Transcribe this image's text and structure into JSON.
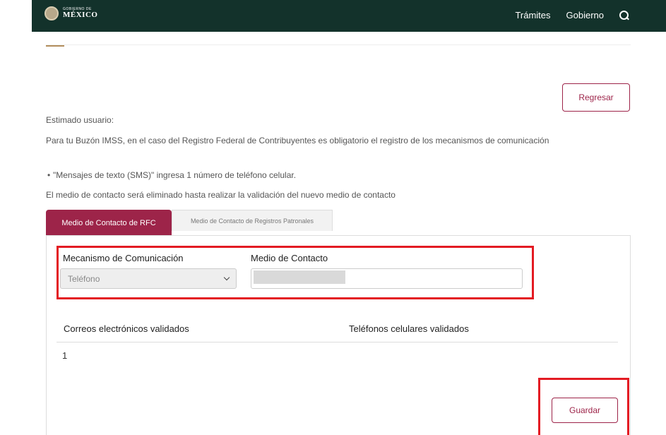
{
  "header": {
    "logo_small": "GOBIERNO DE",
    "logo_big": "MÉXICO",
    "nav": [
      "Trámites",
      "Gobierno"
    ],
    "search_icon": "search-icon"
  },
  "page": {
    "regresar_label": "Regresar",
    "greeting": "Estimado usuario:",
    "paragraph": "Para tu Buzón IMSS, en el caso del Registro Federal de Contribuyentes es obligatorio el registro de los mecanismos de comunicación",
    "bullet": "\"Mensajes de texto (SMS)\" ingresa 1 número de teléfono celular.",
    "notice": "El medio de contacto será eliminado hasta realizar la validación del nuevo medio de contacto"
  },
  "tabs": [
    {
      "label": "Medio de Contacto de RFC",
      "active": true
    },
    {
      "label": "Medio de Contacto de Registros Patronales",
      "active": false
    }
  ],
  "form": {
    "mechanism_label": "Mecanismo de Comunicación",
    "mechanism_value": "Teléfono",
    "contact_label": "Medio de Contacto"
  },
  "validated": {
    "emails_header": "Correos electrónicos validados",
    "phones_header": "Teléfonos celulares validados",
    "email_cell": "1"
  },
  "actions": {
    "guardar_label": "Guardar"
  },
  "colors": {
    "topbar": "#13322b",
    "brand": "#9d2449",
    "accent": "#b38e5d",
    "highlight": "#e31b23"
  }
}
